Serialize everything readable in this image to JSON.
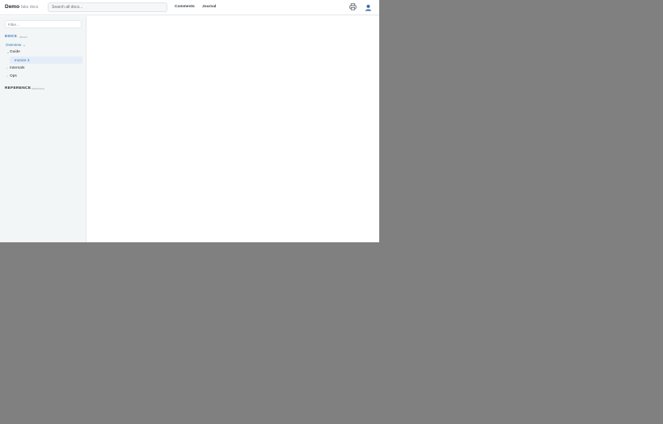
{
  "header": {
    "brand": "Demo",
    "brand_sub": "fake docs",
    "search_placeholder": "Search all docs...",
    "nav": [
      "Comments",
      "Journal"
    ],
    "icons": [
      "printer-icon",
      "user-icon"
    ]
  },
  "sidebar": {
    "filter_placeholder": "Filter…",
    "docs": {
      "title": "DOCS",
      "sub": "about",
      "overview": "Overview →",
      "items": [
        {
          "label": "Guide",
          "expanded": true,
          "children": [
            {
              "label": "Invoice 3",
              "active": true
            }
          ]
        },
        {
          "label": "Internals",
          "expanded": false
        },
        {
          "label": "Ops",
          "expanded": false
        }
      ]
    },
    "reference": {
      "title": "REFERENCE",
      "sub": "reference"
    }
  },
  "colors": {
    "accent": "#2f6fb3",
    "sidebar_bg": "#f3f6f6",
    "active_bg": "#e4edf8",
    "backdrop": "#808080"
  }
}
